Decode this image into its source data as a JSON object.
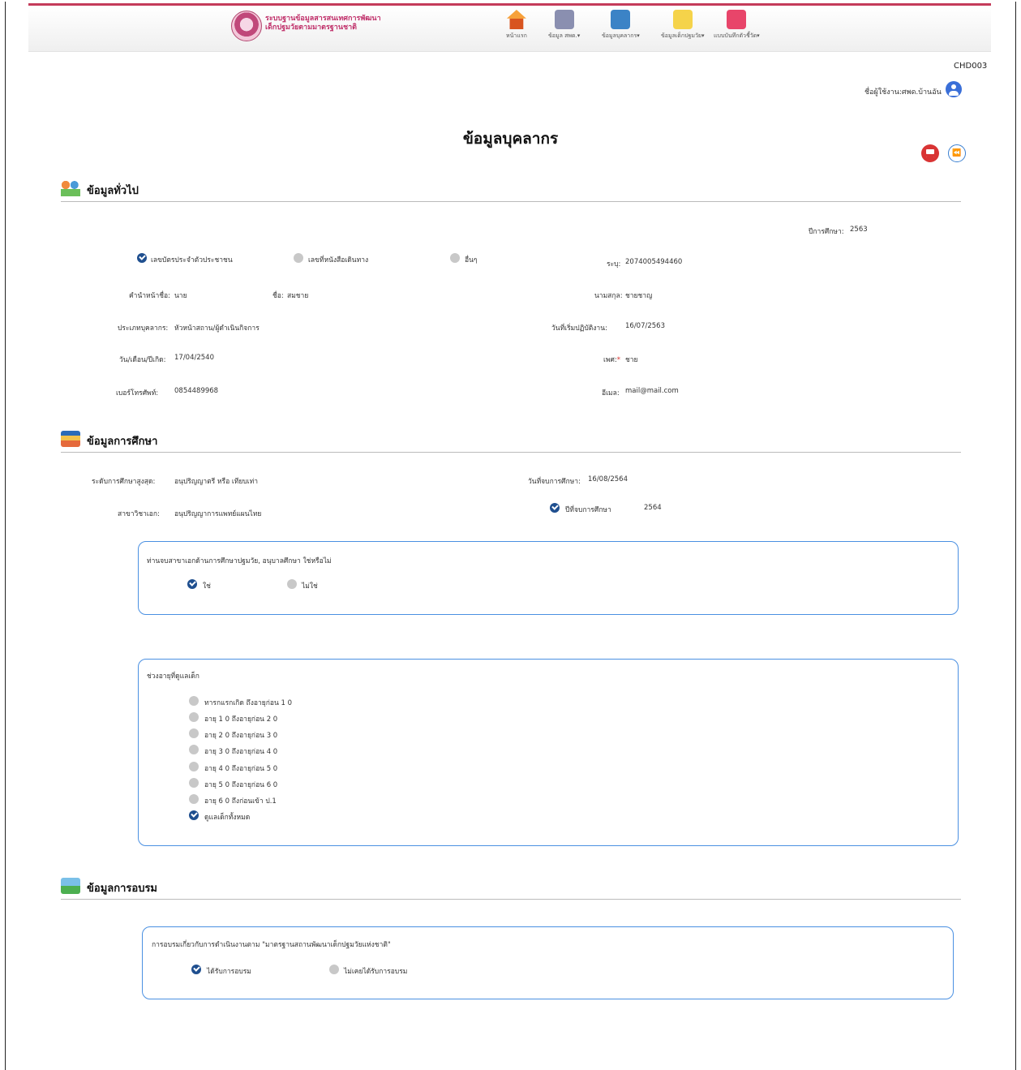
{
  "header": {
    "system_title_line1": "ระบบฐานข้อมูลสารสนเทศการพัฒนา",
    "system_title_line2": "เด็กปฐมวัยตามมาตรฐานชาติ",
    "nav": [
      {
        "label": "หน้าแรก",
        "icon": "home-icon"
      },
      {
        "label": "ข้อมูล สพด.▾",
        "icon": "staff-icon"
      },
      {
        "label": "ข้อมูลบุคลากร▾",
        "icon": "person-search-icon"
      },
      {
        "label": "ข้อมูลเด็กปฐมวัย▾",
        "icon": "document-icon"
      },
      {
        "label": "แบบบันทึกตัวชี้วัด▾",
        "icon": "book-icon"
      }
    ]
  },
  "page_code": "CHD003",
  "user": {
    "label": "ชื่อผู้ใช้งาน:ศพด.บ้านอัน",
    "icon": "user-circle-icon"
  },
  "title": "ข้อมูลบุคลากร",
  "actions": {
    "save_icon": "save-icon",
    "back_icon": "rewind-icon",
    "back_glyph": "⏪"
  },
  "general": {
    "title": "ข้อมูลทั่วไป",
    "academic_year_label": "ปีการศึกษา:",
    "academic_year": "2563",
    "id_types": [
      {
        "label": "เลขบัตรประจำตัวประชาชน",
        "checked": true
      },
      {
        "label": "เลขที่หนังสือเดินทาง",
        "checked": false
      },
      {
        "label": "อื่นๆ",
        "checked": false
      }
    ],
    "id_label": "ระบุ:",
    "id_value": "2074005494460",
    "prefix_label": "คำนำหน้าชื่อ:",
    "prefix_value": "นาย",
    "name_label": "ชื่อ:",
    "name_value": "สมชาย",
    "surname_label": "นามสกุล:",
    "surname_value": "ชายชาญ",
    "type_label": "ประเภทบุคลากร:",
    "type_value": "หัวหน้าสถาน/ผู้ดำเนินกิจการ",
    "start_label": "วันที่เริ่มปฏิบัติงาน:",
    "start_value": "16/07/2563",
    "dob_label": "วัน/เดือน/ปีเกิด:",
    "dob_value": "17/04/2540",
    "sex_label": "เพศ:",
    "sex_required": "*",
    "sex_value": "ชาย",
    "phone_label": "เบอร์โทรศัพท์:",
    "phone_value": "0854489968",
    "email_label": "อีเมล:",
    "email_value": "mail@mail.com"
  },
  "education": {
    "title": "ข้อมูลการศึกษา",
    "level_label": "ระดับการศึกษาสูงสุด:",
    "level_value": "อนุปริญญาตรี หรือ เทียบเท่า",
    "grad_date_label": "วันที่จบการศึกษา:",
    "grad_date_value": "16/08/2564",
    "major_label": "สาขาวิชาเอก:",
    "major_value": "อนุปริญญาการแพทย์แผนไทย",
    "grad_year_label": "ปีที่จบการศึกษา",
    "grad_year_value": "2564",
    "ece_question": "ท่านจบสาขาเอกด้านการศึกษาปฐมวัย, อนุบาลศึกษา ใช่หรือไม่",
    "ece_options": [
      {
        "label": "ใช่",
        "checked": true
      },
      {
        "label": "ไม่ใช่",
        "checked": false
      }
    ],
    "age_question": "ช่วงอายุที่ดูแลเด็ก",
    "age_options": [
      {
        "label": "ทารกแรกเกิด ถึงอายุก่อน 1 0",
        "checked": false
      },
      {
        "label": "อายุ 1 0 ถึงอายุก่อน 2 0",
        "checked": false
      },
      {
        "label": "อายุ 2 0 ถึงอายุก่อน 3 0",
        "checked": false
      },
      {
        "label": "อายุ 3 0 ถึงอายุก่อน 4 0",
        "checked": false
      },
      {
        "label": "อายุ 4 0 ถึงอายุก่อน 5 0",
        "checked": false
      },
      {
        "label": "อายุ 5 0 ถึงอายุก่อน 6 0",
        "checked": false
      },
      {
        "label": "อายุ 6 0 ถึงก่อนเข้า ป.1",
        "checked": false
      },
      {
        "label": "ดูแลเด็กทั้งหมด",
        "checked": true
      }
    ]
  },
  "training": {
    "title": "ข้อมูลการอบรม",
    "question": "การอบรมเกี่ยวกับการดำเนินงานตาม \"มาตรฐานสถานพัฒนาเด็กปฐมวัยแห่งชาติ\"",
    "options": [
      {
        "label": "ได้รับการอบรม",
        "checked": true
      },
      {
        "label": "ไม่เคยได้รับการอบรม",
        "checked": false
      }
    ]
  }
}
